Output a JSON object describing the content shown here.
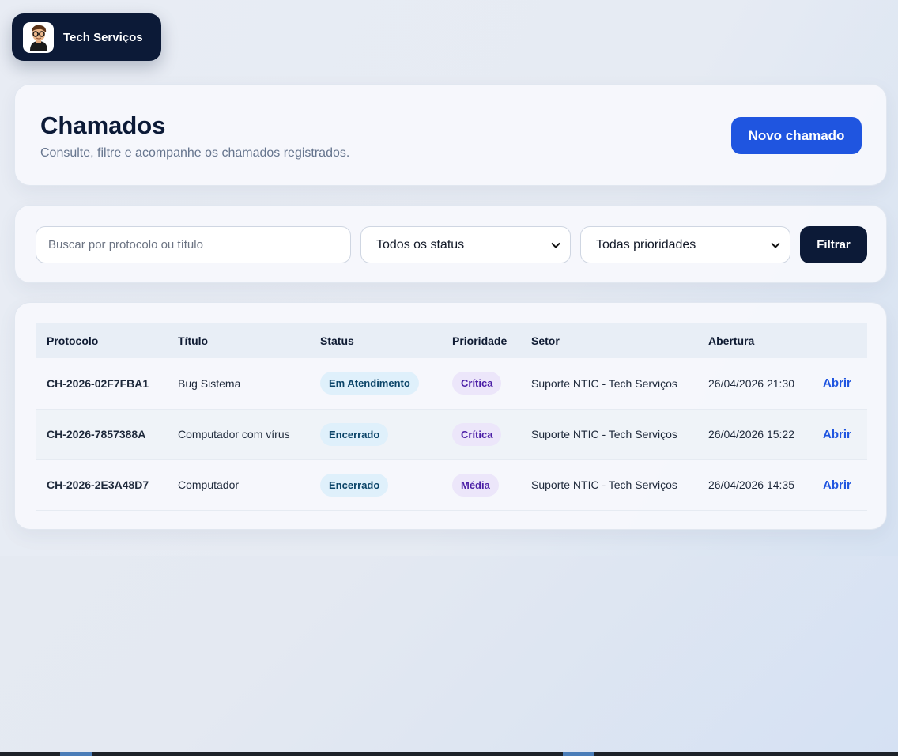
{
  "brand": {
    "name": "Tech Serviços"
  },
  "header": {
    "title": "Chamados",
    "subtitle": "Consulte, filtre e acompanhe os chamados registrados.",
    "new_button": "Novo chamado"
  },
  "filters": {
    "search_placeholder": "Buscar por protocolo ou título",
    "status_selected": "Todos os status",
    "priority_selected": "Todas prioridades",
    "filter_button": "Filtrar"
  },
  "table": {
    "columns": [
      "Protocolo",
      "Título",
      "Status",
      "Prioridade",
      "Setor",
      "Abertura",
      ""
    ],
    "rows": [
      {
        "protocol": "CH-2026-02F7FBA1",
        "title": "Bug Sistema",
        "status": "Em Atendimento",
        "priority": "Crítica",
        "sector": "Suporte NTIC - Tech Serviços",
        "opened": "26/04/2026 21:30",
        "action": "Abrir"
      },
      {
        "protocol": "CH-2026-7857388A",
        "title": "Computador com vírus",
        "status": "Encerrado",
        "priority": "Crítica",
        "sector": "Suporte NTIC - Tech Serviços",
        "opened": "26/04/2026 15:22",
        "action": "Abrir"
      },
      {
        "protocol": "CH-2026-2E3A48D7",
        "title": "Computador",
        "status": "Encerrado",
        "priority": "Média",
        "sector": "Suporte NTIC - Tech Serviços",
        "opened": "26/04/2026 14:35",
        "action": "Abrir"
      }
    ]
  },
  "colors": {
    "brand_dark": "#0c1a37",
    "accent": "#1f55e0",
    "status_badge_bg": "#dff0fb",
    "priority_badge_bg": "#ece6fa"
  }
}
